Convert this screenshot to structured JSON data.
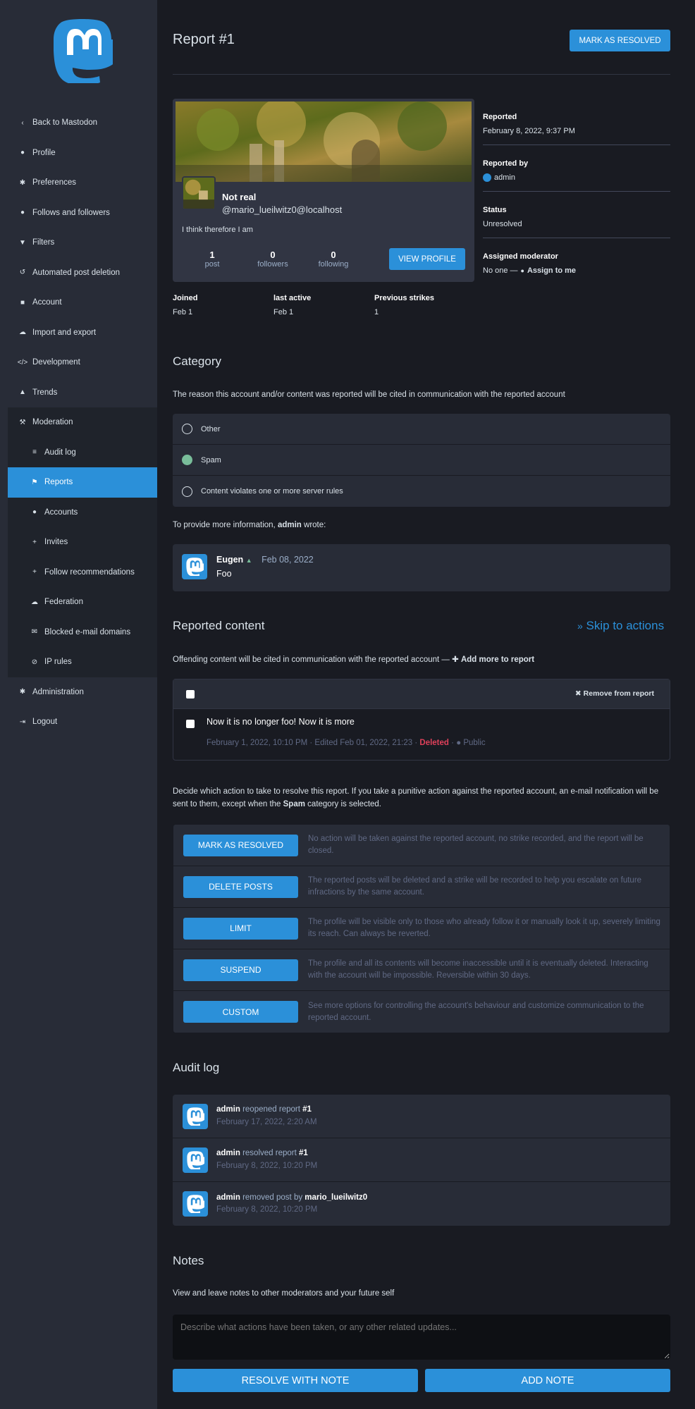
{
  "sidebar": {
    "items": [
      {
        "icon": "chevron-left-icon",
        "glyph": "‹",
        "label": "Back to Mastodon"
      },
      {
        "icon": "user-icon",
        "glyph": "●",
        "label": "Profile"
      },
      {
        "icon": "gear-icon",
        "glyph": "✱",
        "label": "Preferences"
      },
      {
        "icon": "users-icon",
        "glyph": "●",
        "label": "Follows and followers"
      },
      {
        "icon": "filter-icon",
        "glyph": "▼",
        "label": "Filters"
      },
      {
        "icon": "history-icon",
        "glyph": "↺",
        "label": "Automated post deletion"
      },
      {
        "icon": "lock-icon",
        "glyph": "■",
        "label": "Account"
      },
      {
        "icon": "cloud-download-icon",
        "glyph": "☁",
        "label": "Import and export"
      },
      {
        "icon": "code-icon",
        "glyph": "</>",
        "label": "Development"
      },
      {
        "icon": "fire-icon",
        "glyph": "▲",
        "label": "Trends"
      },
      {
        "icon": "gavel-icon",
        "glyph": "⚒",
        "label": "Moderation"
      }
    ],
    "moderation_items": [
      {
        "icon": "list-icon",
        "glyph": "≡",
        "label": "Audit log"
      },
      {
        "icon": "flag-icon",
        "glyph": "⚑",
        "label": "Reports"
      },
      {
        "icon": "users-icon",
        "glyph": "●",
        "label": "Accounts"
      },
      {
        "icon": "user-plus-icon",
        "glyph": "+",
        "label": "Invites"
      },
      {
        "icon": "user-plus-icon",
        "glyph": "+",
        "label": "Follow recommendations"
      },
      {
        "icon": "cloud-icon",
        "glyph": "☁",
        "label": "Federation"
      },
      {
        "icon": "envelope-icon",
        "glyph": "✉",
        "label": "Blocked e-mail domains"
      },
      {
        "icon": "ban-icon",
        "glyph": "⊘",
        "label": "IP rules"
      }
    ],
    "bottom_items": [
      {
        "icon": "cogs-icon",
        "glyph": "✱",
        "label": "Administration"
      },
      {
        "icon": "sign-out-icon",
        "glyph": "⇥",
        "label": "Logout"
      }
    ]
  },
  "header": {
    "title": "Report #1",
    "resolve_button": "Mark as resolved"
  },
  "account": {
    "display_name": "Not real",
    "handle": "@mario_lueilwitz0@localhost",
    "bio": "I think therefore I am",
    "stats": [
      {
        "value": "1",
        "label": "post"
      },
      {
        "value": "0",
        "label": "followers"
      },
      {
        "value": "0",
        "label": "following"
      }
    ],
    "view_profile": "View profile",
    "joined_label": "Joined",
    "joined_value": "Feb 1",
    "last_active_label": "last active",
    "last_active_value": "Feb 1",
    "strikes_label": "Previous strikes",
    "strikes_value": "1"
  },
  "report_info": {
    "reported_label": "Reported",
    "reported_value": "February 8, 2022, 9:37 PM",
    "reported_by_label": "Reported by",
    "reported_by_value": "admin",
    "status_label": "Status",
    "status_value": "Unresolved",
    "assigned_label": "Assigned moderator",
    "assigned_value": "No one —",
    "assign_link": "Assign to me"
  },
  "category": {
    "title": "Category",
    "description": "The reason this account and/or content was reported will be cited in communication with the reported account",
    "options": [
      {
        "label": "Other",
        "selected": false
      },
      {
        "label": "Spam",
        "selected": true
      },
      {
        "label": "Content violates one or more server rules",
        "selected": false
      }
    ]
  },
  "comment": {
    "intro_prefix": "To provide more information,",
    "intro_user": "admin",
    "intro_suffix": "wrote:",
    "author": "Eugen",
    "author_badge": "▲",
    "date": "Feb 08, 2022",
    "text": "Foo"
  },
  "reported_content": {
    "title": "Reported content",
    "skip_link": "Skip to actions",
    "description": "Offending content will be cited in communication with the reported account —",
    "add_more": "Add more to report",
    "remove_label": "Remove from report",
    "post_text": "Now it is no longer foo! Now it is more",
    "post_date": "February 1, 2022, 10:10 PM · Edited Feb 01, 2022, 21:23 ·",
    "post_deleted": "Deleted",
    "post_sep": "·",
    "post_visibility": "Public"
  },
  "actions": {
    "intro_prefix": "Decide which action to take to resolve this report. If you take a punitive action against the reported account, an e-mail notification will be sent to them, except when the",
    "intro_bold": "Spam",
    "intro_suffix": "category is selected.",
    "items": [
      {
        "label": "Mark as resolved",
        "description": "No action will be taken against the reported account, no strike recorded, and the report will be closed."
      },
      {
        "label": "Delete posts",
        "description": "The reported posts will be deleted and a strike will be recorded to help you escalate on future infractions by the same account."
      },
      {
        "label": "Limit",
        "description": "The profile will be visible only to those who already follow it or manually look it up, severely limiting its reach. Can always be reverted."
      },
      {
        "label": "Suspend",
        "description": "The profile and all its contents will become inaccessible until it is eventually deleted. Interacting with the account will be impossible. Reversible within 30 days."
      },
      {
        "label": "Custom",
        "description": "See more options for controlling the account's behaviour and customize communication to the reported account."
      }
    ]
  },
  "audit": {
    "title": "Audit log",
    "entries": [
      {
        "actor": "admin",
        "action": "reopened report",
        "target": "#1",
        "date": "February 17, 2022, 2:20 AM"
      },
      {
        "actor": "admin",
        "action": "resolved report",
        "target": "#1",
        "date": "February 8, 2022, 10:20 PM"
      },
      {
        "actor": "admin",
        "action": "removed post by",
        "target": "mario_lueilwitz0",
        "date": "February 8, 2022, 10:20 PM"
      }
    ]
  },
  "notes": {
    "title": "Notes",
    "description": "View and leave notes to other moderators and your future self",
    "placeholder": "Describe what actions have been taken, or any other related updates...",
    "resolve_with_note": "Resolve with note",
    "add_note": "Add note"
  },
  "colors": {
    "accent": "#2b90d9",
    "deleted": "#df405a",
    "spam_selected": "#79bd9a"
  }
}
